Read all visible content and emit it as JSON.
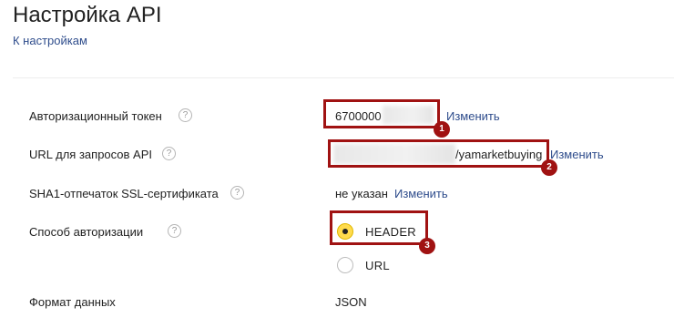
{
  "header": {
    "title": "Настройка API",
    "back_link": "К настройкам"
  },
  "fields": {
    "token": {
      "label": "Авторизационный токен",
      "help": "?",
      "value": "6700000",
      "change_link": "Изменить"
    },
    "url": {
      "label": "URL для запросов API",
      "help": "?",
      "value": "/yamarketbuying",
      "change_link": "Изменить"
    },
    "sha1": {
      "label": "SHA1-отпечаток SSL-сертификата",
      "help": "?",
      "value": "не указан",
      "change_link": "Изменить"
    },
    "auth": {
      "label": "Способ авторизации",
      "help": "?",
      "options": [
        "HEADER",
        "URL"
      ],
      "selected": "HEADER"
    },
    "format": {
      "label": "Формат данных",
      "value": "JSON"
    }
  },
  "annotations": {
    "markers": [
      "1",
      "2",
      "3"
    ],
    "color": "#a01212"
  },
  "colors": {
    "link": "#2f4d8c",
    "radio_checked": "#ffdb4d"
  }
}
